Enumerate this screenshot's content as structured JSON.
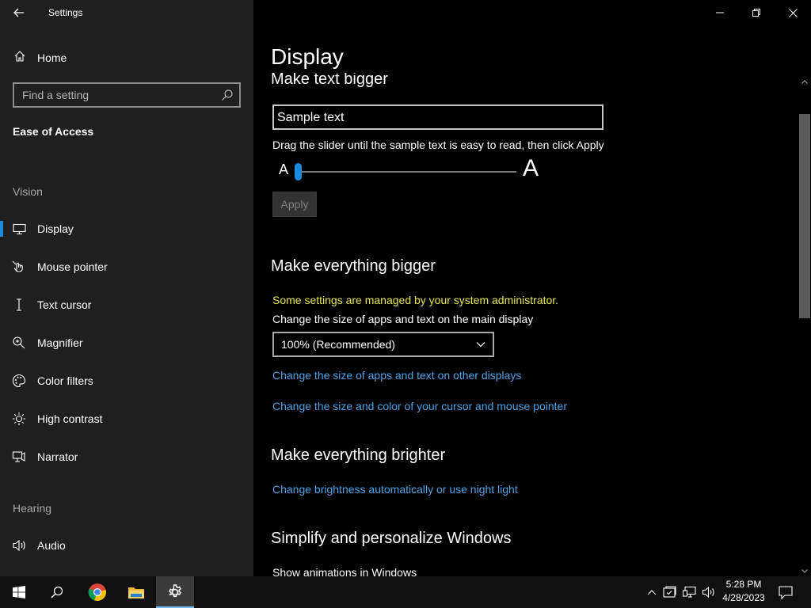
{
  "window": {
    "title": "Settings",
    "back_icon": "back-arrow-icon",
    "controls": [
      "minimize-icon",
      "restore-icon",
      "close-icon"
    ]
  },
  "sidebar": {
    "home_label": "Home",
    "search": {
      "placeholder": "Find a setting",
      "value": ""
    },
    "section_title": "Ease of Access",
    "groups": [
      {
        "header": "Vision",
        "items": [
          {
            "label": "Display",
            "icon": "monitor-icon",
            "selected": true
          },
          {
            "label": "Mouse pointer",
            "icon": "mouse-pointer-icon",
            "selected": false
          },
          {
            "label": "Text cursor",
            "icon": "text-cursor-icon",
            "selected": false
          },
          {
            "label": "Magnifier",
            "icon": "magnifier-icon",
            "selected": false
          },
          {
            "label": "Color filters",
            "icon": "palette-icon",
            "selected": false
          },
          {
            "label": "High contrast",
            "icon": "brightness-icon",
            "selected": false
          },
          {
            "label": "Narrator",
            "icon": "narrator-icon",
            "selected": false
          }
        ]
      },
      {
        "header": "Hearing",
        "items": [
          {
            "label": "Audio",
            "icon": "speaker-icon",
            "selected": false
          }
        ]
      }
    ]
  },
  "main": {
    "page_title": "Display",
    "make_text_bigger": {
      "heading": "Make text bigger",
      "sample_text": "Sample text",
      "instructions": "Drag the slider until the sample text is easy to read, then click Apply",
      "slider_small_label": "A",
      "slider_large_label": "A",
      "slider_value_fraction": 0.0,
      "apply_label": "Apply"
    },
    "make_everything_bigger": {
      "heading": "Make everything bigger",
      "admin_notice": "Some settings are managed by your system administrator.",
      "scale_label": "Change the size of apps and text on the main display",
      "scale_value": "100% (Recommended)",
      "link_other_displays": "Change the size of apps and text on other displays",
      "link_cursor": "Change the size and color of your cursor and mouse pointer"
    },
    "make_everything_brighter": {
      "heading": "Make everything brighter",
      "link_brightness": "Change brightness automatically or use night light"
    },
    "simplify": {
      "heading": "Simplify and personalize Windows",
      "show_animations_label": "Show animations in Windows"
    }
  },
  "taskbar": {
    "apps": [
      "start-icon",
      "search-icon",
      "chrome-icon",
      "file-explorer-icon",
      "settings-gear-icon"
    ],
    "tray": [
      "chevron-up-icon",
      "security-icon",
      "network-icon",
      "volume-icon"
    ],
    "time": "5:28 PM",
    "date": "4/28/2023",
    "notification_icon": "notification-icon"
  },
  "colors": {
    "accent": "#1a8ce0",
    "link": "#4da3e6",
    "warning": "#e8e34e",
    "sidebar_bg": "#1f1f1f",
    "main_bg": "#000000"
  }
}
